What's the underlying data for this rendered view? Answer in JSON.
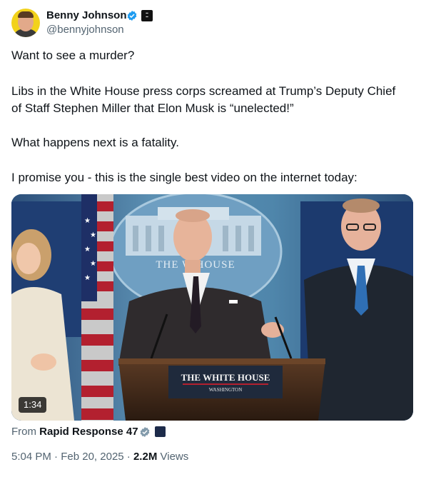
{
  "author": {
    "name": "Benny Johnson",
    "handle": "@bennyjohnson",
    "verified_color": "#1d9bf0"
  },
  "tweet": {
    "paragraphs": [
      "Want to see a murder?",
      "Libs in the White House press corps screamed at Trump’s Deputy Chief\nof Staff Stephen Miller that Elon Musk is “unelected!”",
      "What happens next is a fatality.",
      "I promise you - this is the single best video on the internet today:"
    ]
  },
  "media": {
    "duration": "1:34",
    "seal_text": "THE W       HOUSE",
    "podium_title": "THE WHITE HOUSE",
    "podium_subtitle": "WASHINGTON"
  },
  "attribution": {
    "prefix": "From",
    "source": "Rapid Response 47"
  },
  "meta": {
    "time": "5:04 PM",
    "date": "Feb 20, 2025",
    "views_count": "2.2M",
    "views_label": "Views",
    "separator": "·"
  }
}
